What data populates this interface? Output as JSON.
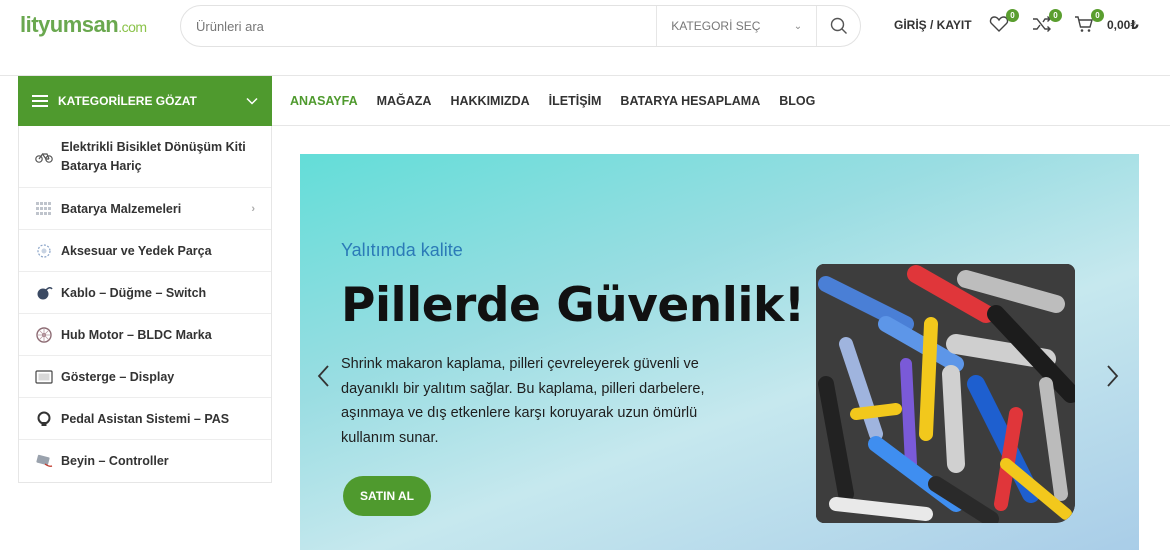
{
  "header": {
    "logo_main": "lityumsan",
    "logo_suffix": ".com",
    "search_placeholder": "Ürünleri ara",
    "category_select": "KATEGORİ SEÇ",
    "login_label": "GİRİŞ / KAYIT",
    "wishlist_count": "0",
    "compare_count": "0",
    "cart_count": "0",
    "cart_total": "0,00₺"
  },
  "nav": {
    "categories_button": "KATEGORİLERE GÖZAT",
    "items": [
      "ANASAYFA",
      "MAĞAZA",
      "HAKKIMIZDA",
      "İLETİŞİM",
      "BATARYA HESAPLAMA",
      "BLOG"
    ]
  },
  "categories": [
    {
      "label": "Elektrikli Bisiklet Dönüşüm Kiti Batarya Hariç",
      "icon": "bicycle-icon"
    },
    {
      "label": "Batarya Malzemeleri",
      "icon": "battery-grid-icon"
    },
    {
      "label": "Aksesuar ve Yedek Parça",
      "icon": "gear-parts-icon"
    },
    {
      "label": "Kablo – Düğme – Switch",
      "icon": "cable-icon"
    },
    {
      "label": "Hub Motor – BLDC Marka",
      "icon": "motor-icon"
    },
    {
      "label": "Gösterge – Display",
      "icon": "display-icon"
    },
    {
      "label": "Pedal Asistan Sistemi – PAS",
      "icon": "pas-sensor-icon"
    },
    {
      "label": "Beyin – Controller",
      "icon": "controller-icon"
    }
  ],
  "banner": {
    "subtitle": "Yalıtımda kalite",
    "title": "Pillerde Güvenlik!",
    "text": "Shrink makaron kaplama, pilleri çevreleyerek güvenli ve dayanıklı bir yalıtım sağlar. Bu kaplama, pilleri darbelere, aşınmaya ve dış etkenlere karşı koruyarak uzun ömürlü kullanım sunar.",
    "button": "SATIN AL"
  },
  "colors": {
    "brand_green": "#4f9a2e",
    "accent_blue": "#2b7ab7"
  }
}
